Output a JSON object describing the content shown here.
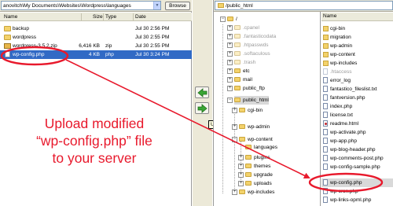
{
  "local": {
    "path": "anovitch\\My Documents\\Websites\\Wordpress\\languages",
    "browse_label": "Browse",
    "columns": {
      "name": "Name",
      "size": "Size",
      "type": "Type",
      "date": "Date"
    },
    "files": [
      {
        "name": "backup",
        "size": "",
        "type": "",
        "date": "Jul 30 2:56 PM",
        "icon": "folder-icon"
      },
      {
        "name": "wordpress",
        "size": "",
        "type": "",
        "date": "Jul 30 2:55 PM",
        "icon": "folder-icon"
      },
      {
        "name": "wordpress-3.5.2.zip",
        "size": "6,416 KB",
        "type": "zip",
        "date": "Jul 30 2:55 PM",
        "icon": "zip-icon"
      },
      {
        "name": "wp-config.php",
        "size": "4 KB",
        "type": "php",
        "date": "Jul 30 3:24 PM",
        "icon": "php-file-icon",
        "selected": true
      }
    ]
  },
  "transfer": {
    "tooltip": "Upload"
  },
  "remote": {
    "path": "/public_html",
    "tree": [
      {
        "label": "/"
      },
      {
        "label": ".cpanel",
        "dim": true
      },
      {
        "label": ".fantasticodata",
        "dim": true
      },
      {
        "label": ".htpasswds",
        "dim": true
      },
      {
        "label": ".softaculous",
        "dim": true
      },
      {
        "label": ".trash",
        "dim": true
      },
      {
        "label": "etc"
      },
      {
        "label": "mail"
      },
      {
        "label": "public_ftp"
      },
      {
        "label": "public_html",
        "selected": true
      },
      {
        "label": "cgi-bin"
      },
      {
        "label": "wp-admin"
      },
      {
        "label": "wp-content"
      },
      {
        "label": "languages"
      },
      {
        "label": "plugins"
      },
      {
        "label": "themes"
      },
      {
        "label": "upgrade"
      },
      {
        "label": "uploads"
      },
      {
        "label": "wp-includes"
      }
    ],
    "files_header": "Name",
    "files": [
      {
        "name": "cgi-bin",
        "kind": "folder"
      },
      {
        "name": "migration",
        "kind": "folder"
      },
      {
        "name": "wp-admin",
        "kind": "folder"
      },
      {
        "name": "wp-content",
        "kind": "folder"
      },
      {
        "name": "wp-includes",
        "kind": "folder"
      },
      {
        "name": ".htaccess",
        "kind": "doc",
        "dim": true
      },
      {
        "name": "error_log",
        "kind": "doc"
      },
      {
        "name": "fantastico_fileslist.txt",
        "kind": "doc"
      },
      {
        "name": "fantversion.php",
        "kind": "doc"
      },
      {
        "name": "index.php",
        "kind": "doc"
      },
      {
        "name": "license.txt",
        "kind": "doc"
      },
      {
        "name": "readme.html",
        "kind": "html"
      },
      {
        "name": "wp-activate.php",
        "kind": "doc"
      },
      {
        "name": "wp-app.php",
        "kind": "doc"
      },
      {
        "name": "wp-blog-header.php",
        "kind": "doc"
      },
      {
        "name": "wp-comments-post.php",
        "kind": "doc"
      },
      {
        "name": "wp-config-sample.php",
        "kind": "doc"
      },
      {
        "name": "wp-config.php",
        "kind": "doc",
        "selected": true
      },
      {
        "name": "wp-cron.php",
        "kind": "doc"
      },
      {
        "name": "wp-includes",
        "kind": "folder"
      },
      {
        "name": "wp-links-opml.php",
        "kind": "doc"
      }
    ]
  },
  "annotation": {
    "lines": [
      "Upload modified",
      "“wp-config.php” file",
      "to your server"
    ]
  },
  "colors": {
    "annotation": "#e8192c",
    "selection": "#316ac5"
  }
}
